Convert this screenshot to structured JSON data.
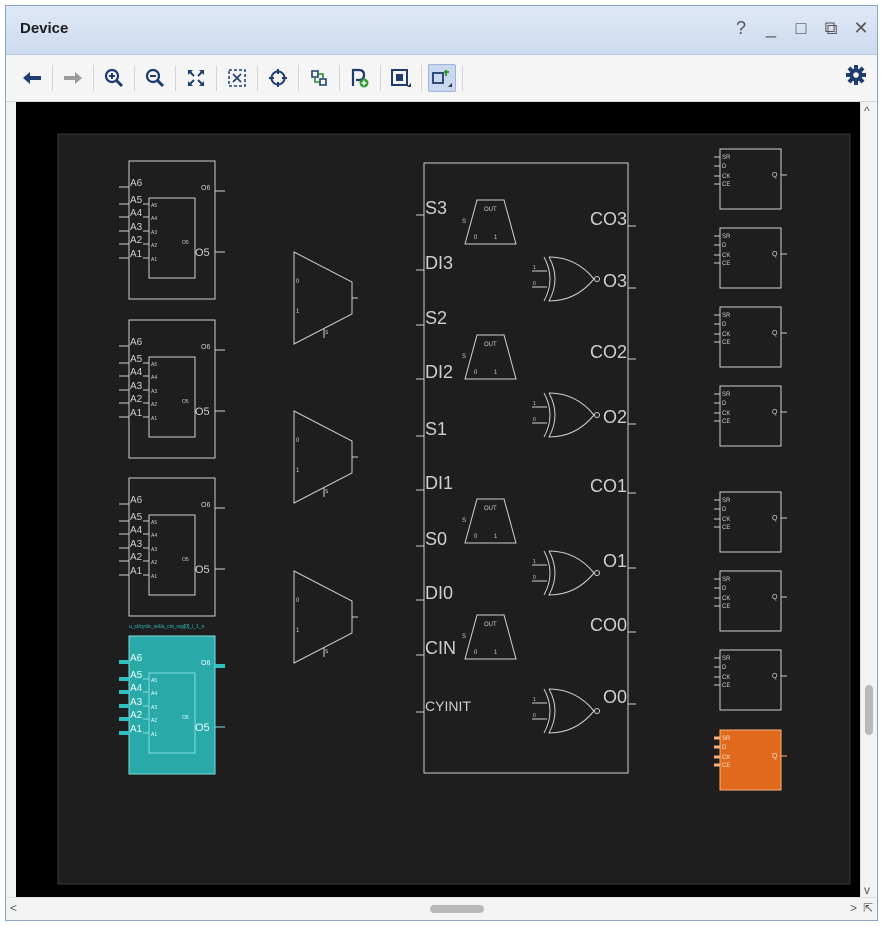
{
  "window": {
    "title": "Device",
    "controls": [
      "?",
      "_",
      "□",
      "⧉",
      "✕"
    ]
  },
  "toolbar": {
    "buttons": [
      {
        "name": "back",
        "icon": "arrow-left-icon"
      },
      {
        "name": "forward",
        "icon": "arrow-right-icon"
      },
      {
        "name": "zoom-in",
        "icon": "zoom-in-icon"
      },
      {
        "name": "zoom-out",
        "icon": "zoom-out-icon"
      },
      {
        "name": "zoom-fit",
        "icon": "fit-icon"
      },
      {
        "name": "zoom-selection",
        "icon": "zoom-area-icon"
      },
      {
        "name": "auto-fit",
        "icon": "crosshair-icon"
      },
      {
        "name": "routing-resources",
        "icon": "routing-icon"
      },
      {
        "name": "add-pblock",
        "icon": "pblock-icon"
      },
      {
        "name": "show-tile",
        "icon": "tile-icon"
      },
      {
        "name": "toggle-view",
        "icon": "view-toggle-icon",
        "active": true
      }
    ],
    "settings_icon": "gear-icon"
  },
  "canvas": {
    "lut_pins": [
      "A6",
      "A5",
      "A4",
      "A3",
      "A2",
      "A1"
    ],
    "lut_inner_pins": [
      "A5",
      "A4",
      "A3",
      "A2",
      "A1"
    ],
    "lut_outputs": [
      "O6",
      "O5"
    ],
    "lut_inner_output": "O5",
    "highlight_label": "u_cl/cycle_sel/a_cnt_reg[0]_i_1_n",
    "carry_pins": [
      "S3",
      "DI3",
      "S2",
      "DI2",
      "S1",
      "DI1",
      "S0",
      "DI0",
      "CIN",
      "CYINIT"
    ],
    "carry_outputs": [
      "CO3",
      "O3",
      "CO2",
      "O2",
      "CO1",
      "O1",
      "CO0",
      "O0"
    ],
    "mux_labels": {
      "out": "OUT",
      "s": "S",
      "a": "0",
      "b": "1"
    },
    "ff_pins": [
      "SR",
      "D",
      "CK",
      "CE"
    ],
    "ff_output": "Q",
    "colors": {
      "background": "#000000",
      "site": "#1e1e1e",
      "line": "#cfcfcf",
      "lut_highlight": "#2aa9a9",
      "ff_highlight": "#e0691c"
    }
  }
}
